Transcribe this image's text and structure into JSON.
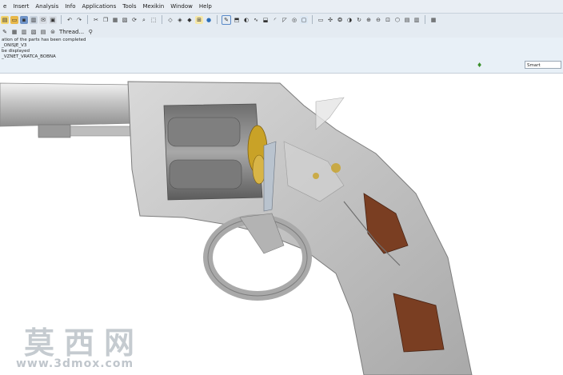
{
  "menu": [
    "e",
    "Insert",
    "Analysis",
    "Info",
    "Applications",
    "Tools",
    "Mexikin",
    "Window",
    "Help"
  ],
  "toolbar": {
    "thread_label": "Thread..."
  },
  "messages": [
    "ation of the parts has been completed",
    "_ONISJE_V3",
    "be displayed",
    "_VZNET_VRATCA_BOBNA"
  ],
  "filter": {
    "value": "Smart"
  },
  "watermark": {
    "title": "莫西网",
    "url": "www.3dmox.com"
  },
  "colors": {
    "body_metal": "#c9c9c9",
    "brass": "#c9a227",
    "grip_wood": "#7a3e22",
    "accent_green": "#3a8f2a"
  }
}
